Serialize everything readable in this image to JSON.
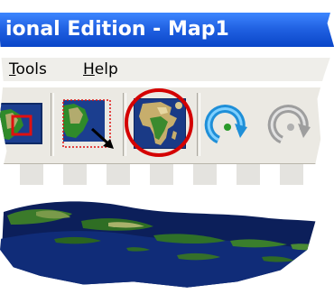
{
  "window": {
    "title": "ional Edition - Map1"
  },
  "menu": {
    "tools": {
      "accel": "T",
      "rest": "ools"
    },
    "help": {
      "accel": "H",
      "rest": "elp"
    }
  },
  "toolbar": {
    "buttons": [
      {
        "icon": "map-layer-icon"
      },
      {
        "icon": "zoom-to-selection-icon"
      },
      {
        "icon": "full-extent-globe-icon",
        "highlighted": true
      },
      {
        "icon": "refresh-icon"
      },
      {
        "icon": "refresh-disabled-icon"
      }
    ]
  },
  "colors": {
    "titlebar": "#1f5fe0",
    "highlight_ring": "#d40000",
    "globe_ocean": "#1a3a86",
    "land_green": "#3b8a2e"
  }
}
